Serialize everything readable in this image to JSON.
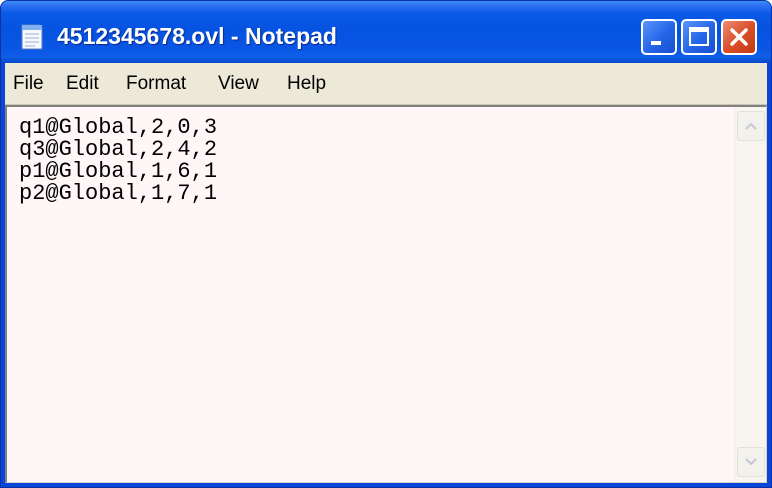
{
  "window": {
    "title": "4512345678.ovl - Notepad",
    "icon": "notepad-icon"
  },
  "titlebar_buttons": {
    "minimize": "minimize-icon",
    "maximize": "maximize-icon",
    "close": "close-icon"
  },
  "menu": {
    "items": [
      {
        "label": "File"
      },
      {
        "label": "Edit"
      },
      {
        "label": "Format"
      },
      {
        "label": "View"
      },
      {
        "label": "Help"
      }
    ]
  },
  "editor": {
    "lines": [
      "q1@Global,2,0,3",
      "q3@Global,2,4,2",
      "p1@Global,1,6,1",
      "p2@Global,1,7,1"
    ]
  },
  "scrollbar": {
    "up": "scroll-up-arrow-icon",
    "down": "scroll-down-arrow-icon"
  },
  "colors": {
    "titlebar": "#0553e0",
    "close_button": "#d9502a",
    "menu_background": "#ece9d8",
    "editor_background": "#fff7f7"
  }
}
